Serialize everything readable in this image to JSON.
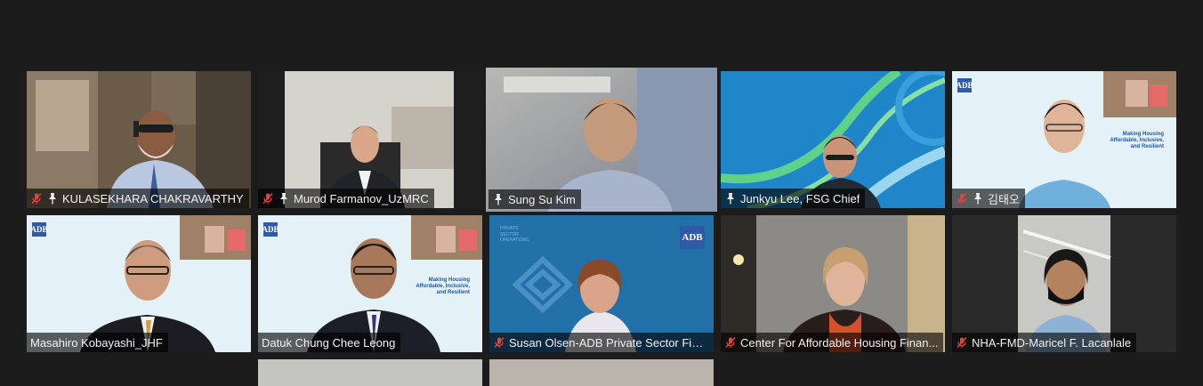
{
  "app": {
    "name": "Video conference gallery view"
  },
  "colors": {
    "background": "#1c1c1c",
    "active_speaker_border": "#c9e86a",
    "muted_icon": "#e0443a",
    "adb_blue": "#2e5aa8"
  },
  "participants": [
    {
      "name": "KULASEKHARA CHAKRAVARTHY",
      "muted": true,
      "pinned": true,
      "background": "office"
    },
    {
      "name": "Murod Farmanov_UzMRC",
      "muted": true,
      "pinned": true,
      "background": "office-light"
    },
    {
      "name": "Sung Su Kim",
      "muted": false,
      "pinned": true,
      "active": true,
      "background": "blurred"
    },
    {
      "name": "Junkyu Lee, FSG Chief",
      "muted": false,
      "pinned": true,
      "background": "green-blue-curves"
    },
    {
      "name": "김태오",
      "muted": true,
      "pinned": true,
      "background": "adb-slide"
    },
    {
      "name": "Masahiro Kobayashi_JHF",
      "muted": false,
      "pinned": false,
      "background": "adb-slide"
    },
    {
      "name": "Datuk Chung Chee Leong",
      "muted": false,
      "pinned": false,
      "background": "adb-slide"
    },
    {
      "name": "Susan Olsen-ADB Private Sector Fina...",
      "muted": true,
      "pinned": false,
      "background": "adb-blue"
    },
    {
      "name": "Center For Affordable Housing Finan...",
      "muted": true,
      "pinned": false,
      "background": "room"
    },
    {
      "name": "NHA-FMD-Maricel F. Lacanlale",
      "muted": true,
      "pinned": false,
      "background": "ceiling"
    }
  ],
  "slide": {
    "logo": "ADB",
    "title_lines": [
      "Making Housing",
      "Affordable, Inclusive,",
      "and Resilient"
    ]
  },
  "adb_background": {
    "logo": "ADB",
    "caption_lines": [
      "PRIVATE",
      "SECTOR",
      "OPERATIONS"
    ]
  }
}
